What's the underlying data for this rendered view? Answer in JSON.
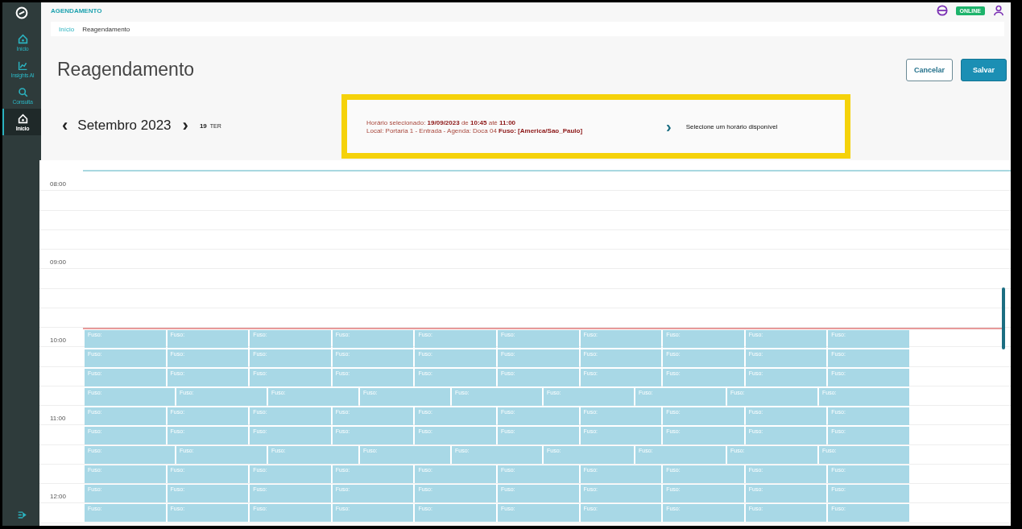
{
  "app": {
    "module": "AGENDAMENTO",
    "status": "ONLINE"
  },
  "sidebar": {
    "items": [
      {
        "kind": "home",
        "label": "Início",
        "selected": false
      },
      {
        "kind": "chart",
        "label": "Insights AI",
        "selected": false
      },
      {
        "kind": "search",
        "label": "Consulta",
        "selected": false
      },
      {
        "kind": "home",
        "label": "Início",
        "selected": true
      }
    ]
  },
  "breadcrumb": [
    "Início",
    "Reagendamento"
  ],
  "page_title": "Reagendamento",
  "buttons": [
    {
      "kind": "outline",
      "label": "Cancelar"
    },
    {
      "kind": "primary",
      "label": "Salvar"
    }
  ],
  "date_nav": {
    "prev": "‹",
    "month": "Setembro 2023",
    "next": "›",
    "day": "19",
    "weekday": "TER"
  },
  "selection": {
    "line_1": "Horário selecionado: **19/09/2023** de **10:45** até **11:00**",
    "line_2": "Local: Portaria 1 - Entrada - Agenda: Doca 04 **Fuso: [America/Sao_Paulo]**",
    "arrow": "›",
    "hint": "Selecione um horário disponível"
  },
  "calendar": {
    "hours": [
      "08:00",
      "09:00",
      "10:00",
      "11:00",
      "12:00"
    ],
    "slot_rows": [
      [
        "Fuso:",
        "Fuso:",
        "Fuso:",
        "Fuso:",
        "Fuso:",
        "Fuso:",
        "Fuso:",
        "Fuso:",
        "Fuso:",
        "Fuso:"
      ],
      [
        "Fuso:",
        "Fuso:",
        "Fuso:",
        "Fuso:",
        "Fuso:",
        "Fuso:",
        "Fuso:",
        "Fuso:",
        "Fuso:",
        "Fuso:"
      ],
      [
        "Fuso:",
        "Fuso:",
        "Fuso:",
        "Fuso:",
        "Fuso:",
        "Fuso:",
        "Fuso:",
        "Fuso:",
        "Fuso:",
        "Fuso:"
      ],
      [
        "Fuso:",
        "Fuso:",
        "Fuso:",
        "Fuso:",
        "Fuso:",
        "Fuso:",
        "Fuso:",
        "Fuso:",
        "Fuso:"
      ],
      [
        "Fuso:",
        "Fuso:",
        "Fuso:",
        "Fuso:",
        "Fuso:",
        "Fuso:",
        "Fuso:",
        "Fuso:",
        "Fuso:",
        "Fuso:"
      ],
      [
        "Fuso:",
        "Fuso:",
        "Fuso:",
        "Fuso:",
        "Fuso:",
        "Fuso:",
        "Fuso:",
        "Fuso:",
        "Fuso:",
        "Fuso:"
      ],
      [
        "Fuso:",
        "Fuso:",
        "Fuso:",
        "Fuso:",
        "Fuso:",
        "Fuso:",
        "Fuso:",
        "Fuso:",
        "Fuso:"
      ],
      [
        "Fuso:",
        "Fuso:",
        "Fuso:",
        "Fuso:",
        "Fuso:",
        "Fuso:",
        "Fuso:",
        "Fuso:",
        "Fuso:",
        "Fuso:"
      ],
      [
        "Fuso:",
        "Fuso:",
        "Fuso:",
        "Fuso:",
        "Fuso:",
        "Fuso:",
        "Fuso:",
        "Fuso:",
        "Fuso:",
        "Fuso:"
      ],
      [
        "Fuso:",
        "Fuso:",
        "Fuso:",
        "Fuso:",
        "Fuso:",
        "Fuso:",
        "Fuso:",
        "Fuso:",
        "Fuso:",
        "Fuso:"
      ]
    ]
  }
}
